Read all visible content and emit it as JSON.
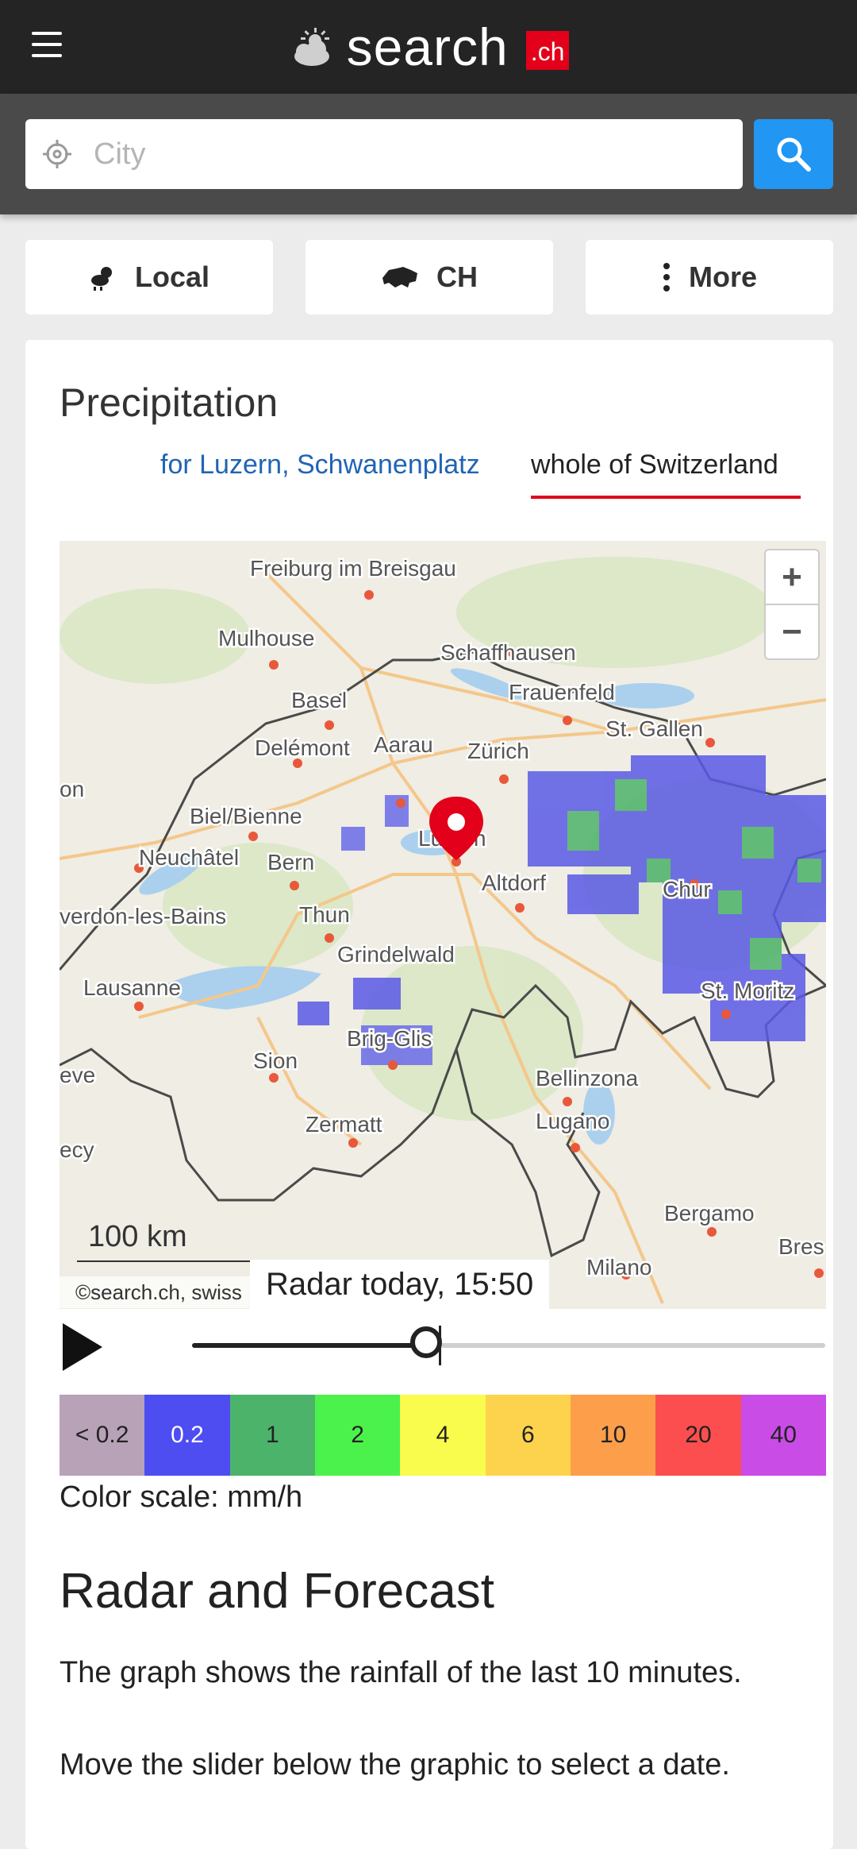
{
  "header": {
    "brand_word": "search",
    "brand_suffix": ".ch"
  },
  "search": {
    "placeholder": "City"
  },
  "nav": {
    "local": "Local",
    "ch": "CH",
    "more": "More"
  },
  "precipitation": {
    "title": "Precipitation",
    "tab_local": "for Luzern, Schwanenplatz",
    "tab_switzerland": "whole of Switzerland",
    "active_tab": "whole of Switzerland"
  },
  "map": {
    "labels": [
      {
        "text": "Freiburg im Breisgau"
      },
      {
        "text": "Mulhouse"
      },
      {
        "text": "Schaffhausen"
      },
      {
        "text": "Basel"
      },
      {
        "text": "Frauenfeld"
      },
      {
        "text": "St. Gallen"
      },
      {
        "text": "Delémont"
      },
      {
        "text": "Aarau"
      },
      {
        "text": "Zürich"
      },
      {
        "text": "Biel/Bienne"
      },
      {
        "text": "Luzern"
      },
      {
        "text": "Neuchâtel"
      },
      {
        "text": "Bern"
      },
      {
        "text": "Altdorf"
      },
      {
        "text": "Chur"
      },
      {
        "text": "verdon-les-Bains"
      },
      {
        "text": "Thun"
      },
      {
        "text": "Grindelwald"
      },
      {
        "text": "Lausanne"
      },
      {
        "text": "St. Moritz"
      },
      {
        "text": "Brig-Glis"
      },
      {
        "text": "Sion"
      },
      {
        "text": "Bellinzona"
      },
      {
        "text": "Zermatt"
      },
      {
        "text": "Lugano"
      },
      {
        "text": "Bergamo"
      },
      {
        "text": "Milano"
      },
      {
        "text": "Bres"
      },
      {
        "text": "on"
      },
      {
        "text": "eve"
      },
      {
        "text": "ecy"
      }
    ],
    "zoom_in": "+",
    "zoom_out": "−",
    "scale": "100 km",
    "attribution": "©search.ch, swiss",
    "radar_time": "Radar today, 15:50"
  },
  "slider": {
    "position_fraction": 0.37
  },
  "color_scale": {
    "items": [
      {
        "label": "< 0.2",
        "color": "#b8a2b8"
      },
      {
        "label": "0.2",
        "color": "#4d4df2"
      },
      {
        "label": "1",
        "color": "#4cb36a"
      },
      {
        "label": "2",
        "color": "#4cf24c"
      },
      {
        "label": "4",
        "color": "#f9fb4d"
      },
      {
        "label": "6",
        "color": "#fdd34d"
      },
      {
        "label": "10",
        "color": "#fd9f4a"
      },
      {
        "label": "20",
        "color": "#fc4e4e"
      },
      {
        "label": "40",
        "color": "#c94ce6"
      }
    ],
    "caption": "Color scale: mm/h"
  },
  "info": {
    "title": "Radar and Forecast",
    "p1": "The graph shows the rainfall of the last 10 minutes.",
    "p2": "Move the slider below the graphic to select a date."
  },
  "colors": {
    "accent": "#e2001a",
    "link": "#2064b4",
    "search_button": "#2196f3"
  }
}
